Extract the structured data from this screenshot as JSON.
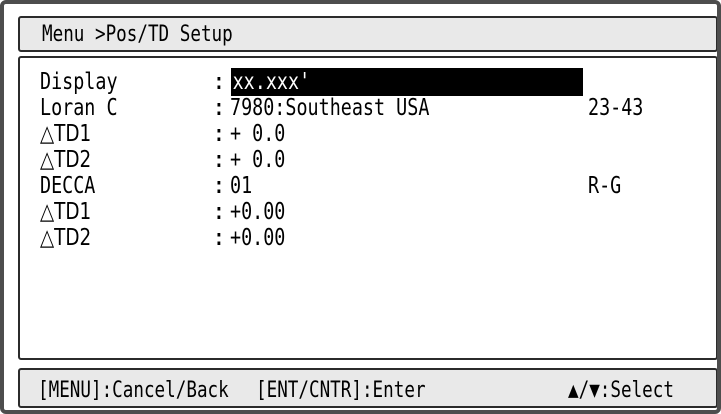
{
  "title": "Menu >Pos/TD Setup",
  "rows": [
    {
      "label": "Display",
      "value": "xx.xxx'",
      "extra": ""
    },
    {
      "label": "Loran C",
      "value": "7980:Southeast USA",
      "extra": "23-43"
    },
    {
      "label": "△TD1",
      "value": "+ 0.0",
      "extra": ""
    },
    {
      "label": "△TD2",
      "value": "+ 0.0",
      "extra": ""
    },
    {
      "label": "DECCA",
      "value": "01",
      "extra": "R-G"
    },
    {
      "label": "△TD1",
      "value": "+0.00",
      "extra": ""
    },
    {
      "label": "△TD2",
      "value": "+0.00",
      "extra": ""
    }
  ],
  "separator": ":",
  "footer": {
    "cancel": "[MENU]:Cancel/Back",
    "enter": "[ENT/CNTR]:Enter",
    "select": "▲/▼:Select"
  }
}
